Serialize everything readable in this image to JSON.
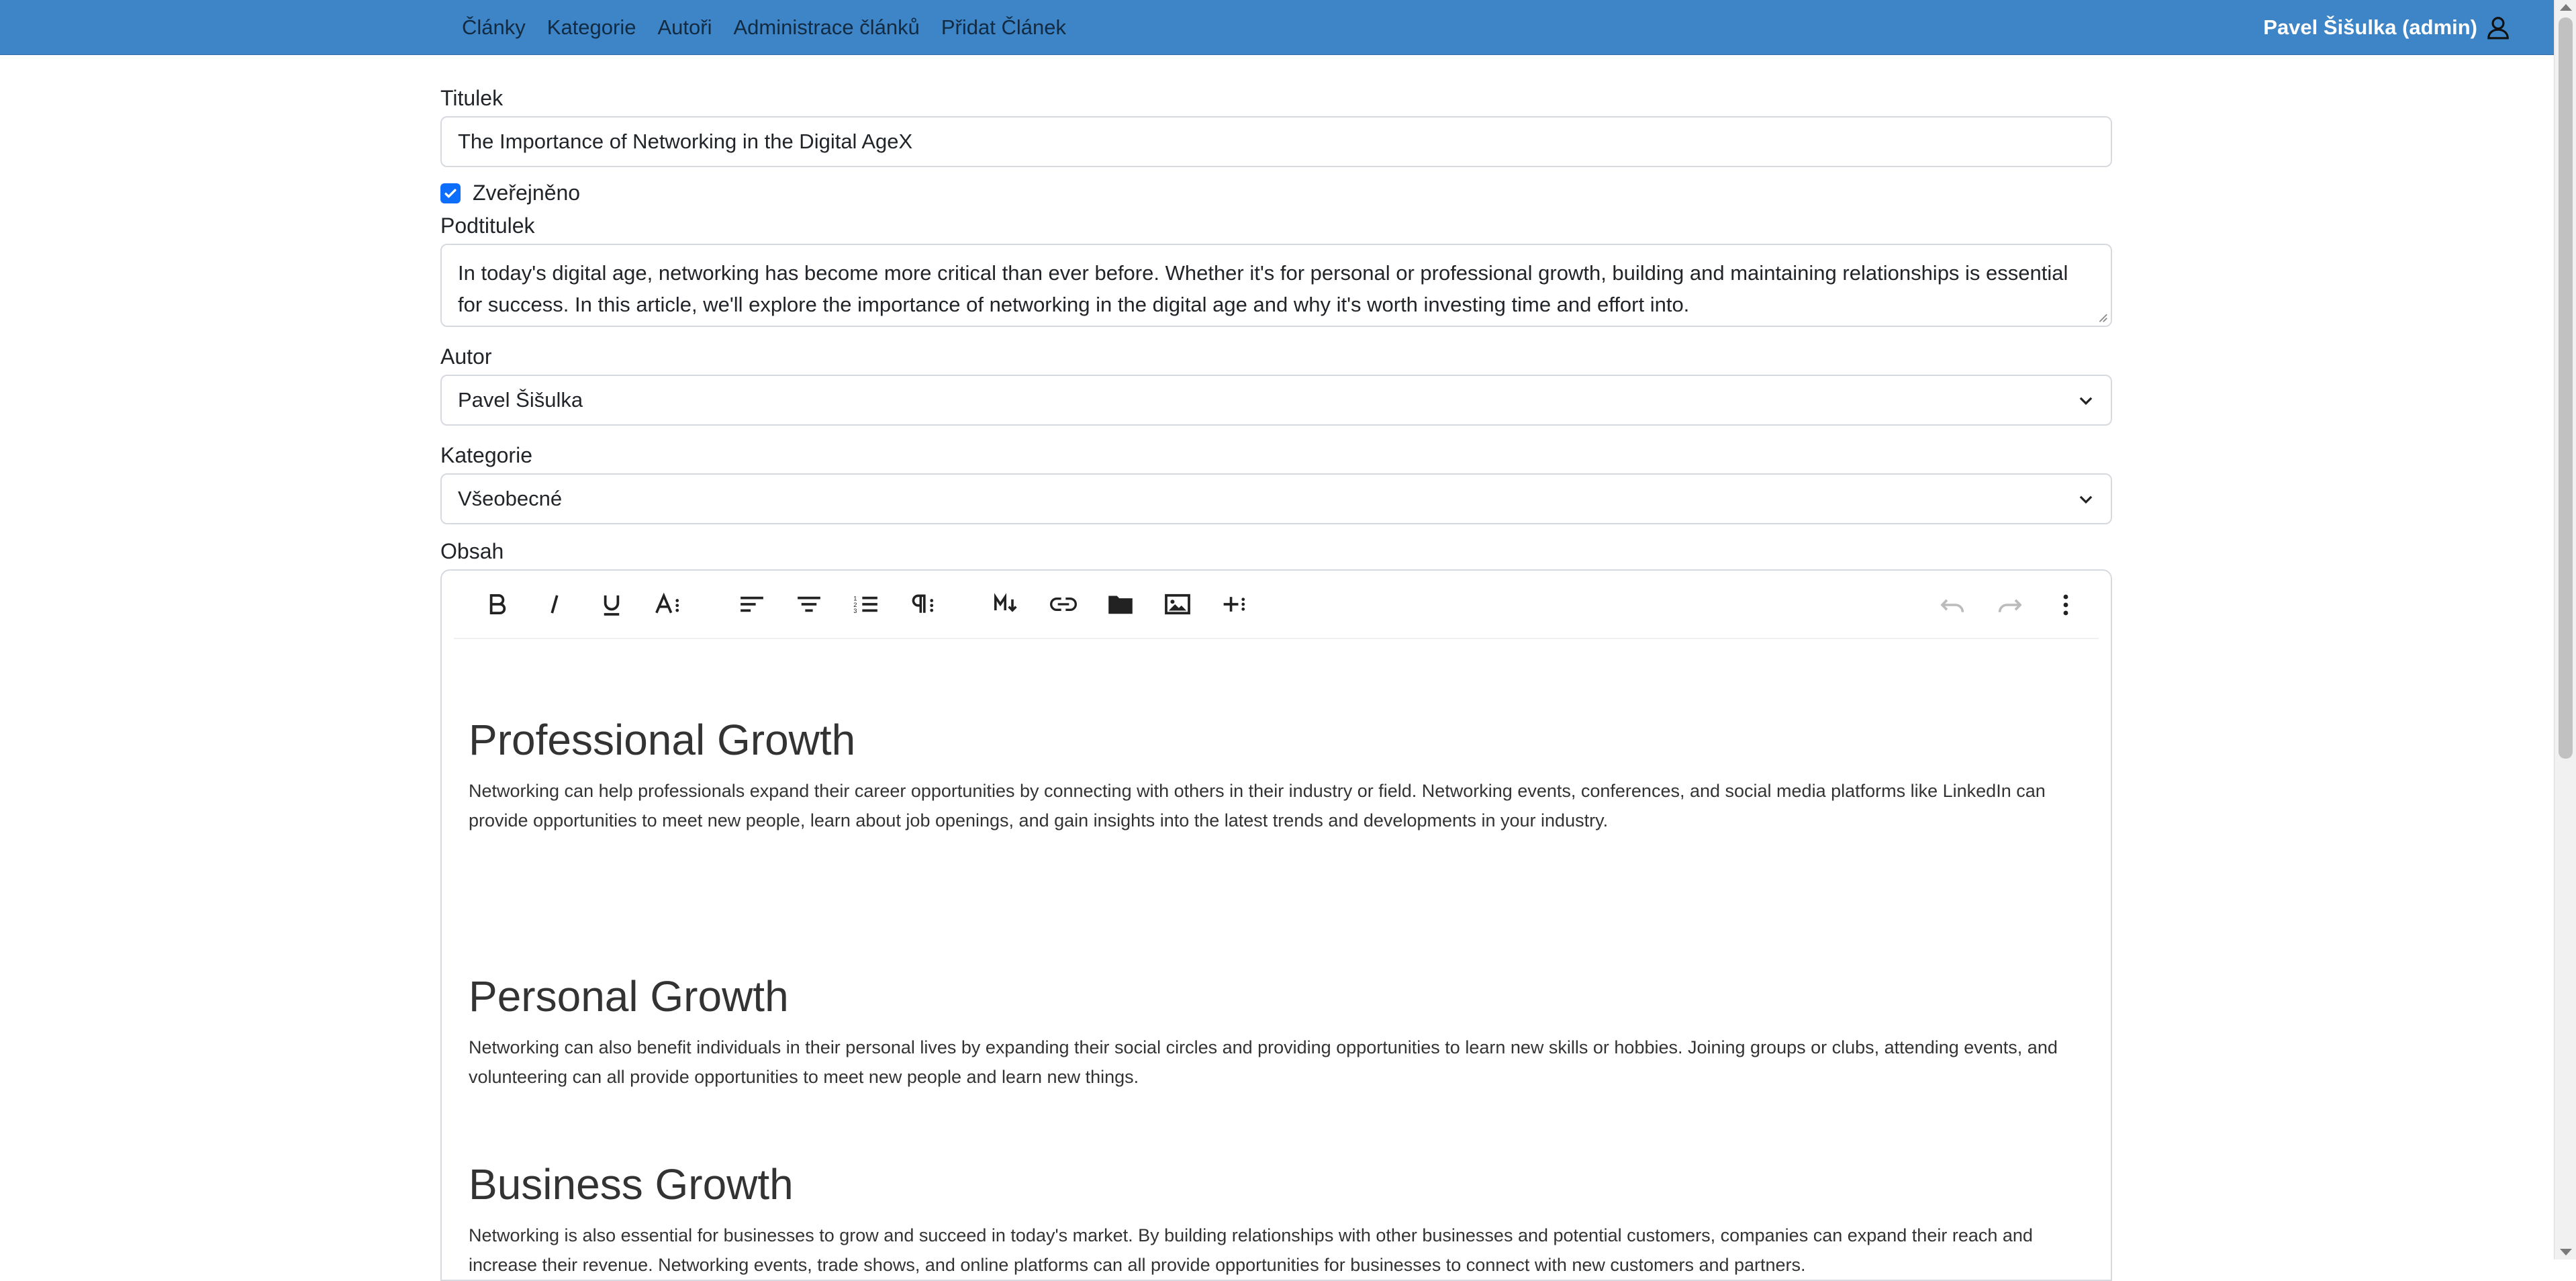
{
  "nav": {
    "links": [
      "Články",
      "Kategorie",
      "Autoři",
      "Administrace článků",
      "Přidat Článek"
    ],
    "user": "Pavel Šišulka (admin)"
  },
  "form": {
    "title_label": "Titulek",
    "title_value": "The Importance of Networking in the Digital AgeX",
    "published_label": "Zveřejněno",
    "published": true,
    "subtitle_label": "Podtitulek",
    "subtitle_value": "In today's digital age, networking has become more critical than ever before. Whether it's for personal or professional growth, building and maintaining relationships is essential for success. In this article, we'll explore the importance of networking in the digital age and why it's worth investing time and effort into.",
    "author_label": "Autor",
    "author_value": "Pavel Šišulka",
    "category_label": "Kategorie",
    "category_value": "Všeobecné",
    "content_label": "Obsah"
  },
  "editor": {
    "toolbar": [
      "bold",
      "italic",
      "underline",
      "font-size",
      "align-left",
      "align-center",
      "ordered-list",
      "paragraph",
      "markdown",
      "link",
      "folder",
      "image",
      "insert-more",
      "undo",
      "redo",
      "more"
    ],
    "sections": [
      {
        "heading": "Professional Growth",
        "text": "Networking can help professionals expand their career opportunities by connecting with others in their industry or field. Networking events, conferences, and social media platforms like LinkedIn can provide opportunities to meet new people, learn about job openings, and gain insights into the latest trends and developments in your industry."
      },
      {
        "heading": "Personal Growth",
        "text": "Networking can also benefit individuals in their personal lives by expanding their social circles and providing opportunities to learn new skills or hobbies. Joining groups or clubs, attending events, and volunteering can all provide opportunities to meet new people and learn new things."
      },
      {
        "heading": "Business Growth",
        "text": "Networking is also essential for businesses to grow and succeed in today's market. By building relationships with other businesses and potential customers, companies can expand their reach and increase their revenue. Networking events, trade shows, and online platforms can all provide opportunities for businesses to connect with new customers and partners."
      }
    ]
  },
  "colors": {
    "navbar": "#3d85c6",
    "checkbox": "#0d6efd"
  }
}
